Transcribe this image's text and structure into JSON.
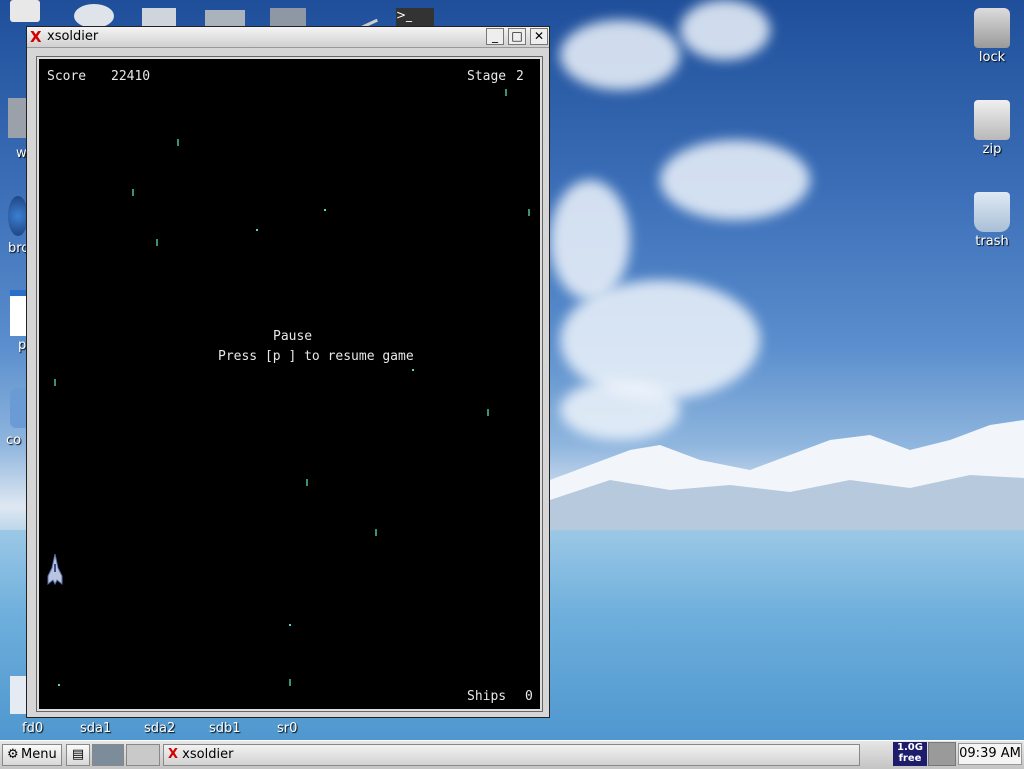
{
  "window": {
    "title": "xsoldier",
    "minimize_glyph": "_",
    "maximize_glyph": "□",
    "close_glyph": "✕"
  },
  "game": {
    "score_label": "Score",
    "score_value": "22410",
    "stage_label": "Stage",
    "stage_value": "2",
    "pause_title": "Pause",
    "pause_hint": "Press [p ] to resume game",
    "ships_label": "Ships",
    "ships_value": "0"
  },
  "desktop": {
    "right_icons": [
      {
        "label": "lock",
        "icon": "lock-icon"
      },
      {
        "label": "zip",
        "icon": "zip-icon"
      },
      {
        "label": "trash",
        "icon": "trash-icon"
      }
    ],
    "left_labels": [
      "w",
      "bro",
      "p",
      "co"
    ],
    "drives": [
      "fd0",
      "sda1",
      "sda2",
      "sdb1",
      "sr0"
    ]
  },
  "taskbar": {
    "menu_label": "Menu",
    "task_label": "xsoldier",
    "disk_free_value": "1.0G",
    "disk_free_label": "free",
    "clock": "09:39 AM"
  },
  "colors": {
    "window_bg": "#000000",
    "close_x": "#d40000",
    "star": "#5fd0d0"
  }
}
